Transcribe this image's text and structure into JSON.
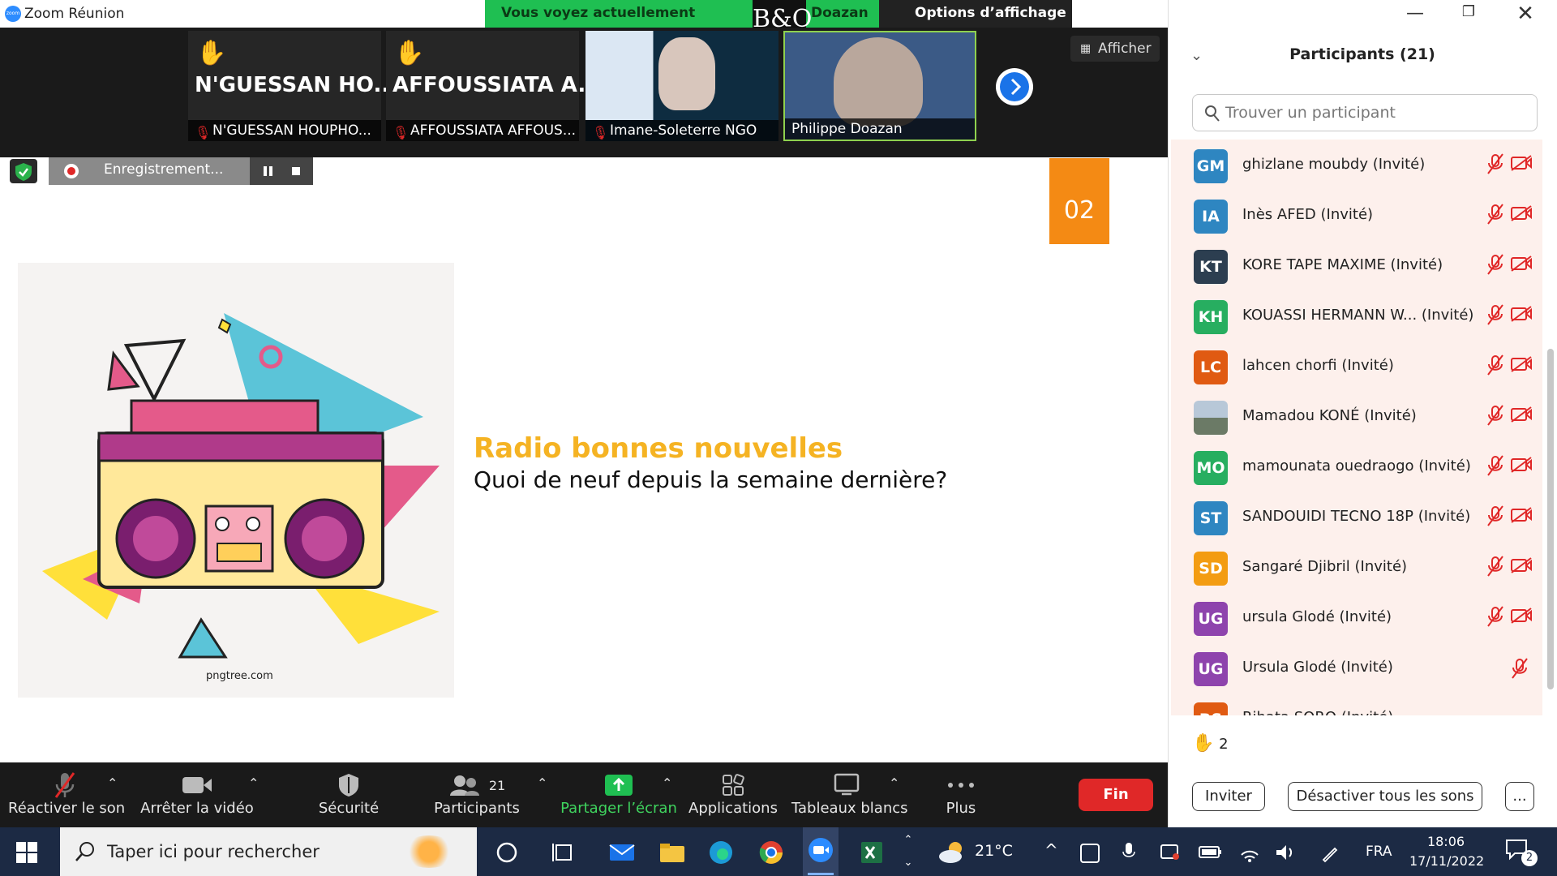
{
  "window": {
    "title": "Zoom Réunion",
    "share_banner_left": "Vous voyez actuellement l’écran de",
    "share_banner_right": "Doazan",
    "view_options": "Options d’affichage",
    "logo_text": "B&O"
  },
  "gallery": {
    "tiles": [
      {
        "big": "N'GUESSAN  HO...",
        "name": "N'GUESSAN HOUPHO...",
        "hand": true
      },
      {
        "big": "AFFOUSSIATA  A...",
        "name": "AFFOUSSIATA AFFOUS...",
        "hand": true
      },
      {
        "name": "Imane-Soleterre NGO"
      },
      {
        "name": "Philippe Doazan"
      }
    ],
    "afficher": "Afficher"
  },
  "recording": {
    "label": "Enregistrement..."
  },
  "slide": {
    "number": "02",
    "title": "Radio bonnes nouvelles",
    "subtitle": "Quoi de neuf depuis la semaine dernière?",
    "watermark": "pngtree.com"
  },
  "toolbar": {
    "unmute": "Réactiver le son",
    "stop_video": "Arrêter la vidéo",
    "security": "Sécurité",
    "participants": "Participants",
    "participants_count": "21",
    "share": "Partager l’écran",
    "apps": "Applications",
    "whiteboards": "Tableaux blancs",
    "more": "Plus",
    "end": "Fin"
  },
  "panel": {
    "title": "Participants (21)",
    "search_placeholder": "Trouver un participant",
    "participants": [
      {
        "initials": "GM",
        "name": "ghizlane moubdy (Invité)",
        "color": "#2e86c1",
        "video_off": true
      },
      {
        "initials": "IA",
        "name": "Inès AFED (Invité)",
        "color": "#2e86c1",
        "video_off": true
      },
      {
        "initials": "KT",
        "name": "KORE TAPE MAXIME (Invité)",
        "color": "#2c3e50",
        "video_off": true
      },
      {
        "initials": "KH",
        "name": "KOUASSI HERMANN W...  (Invité)",
        "color": "#27ae60",
        "video_off": true
      },
      {
        "initials": "LC",
        "name": "lahcen chorfi (Invité)",
        "color": "#e05a12",
        "video_off": true
      },
      {
        "initials": "",
        "name": "Mamadou KONÉ (Invité)",
        "color": "#7a8ea0",
        "video_off": true
      },
      {
        "initials": "MO",
        "name": "mamounata ouedraogo (Invité)",
        "color": "#27ae60",
        "video_off": true
      },
      {
        "initials": "ST",
        "name": "SANDOUIDI TECNO 18P (Invité)",
        "color": "#2e86c1",
        "video_off": true
      },
      {
        "initials": "SD",
        "name": "Sangaré Djibril (Invité)",
        "color": "#f39c12",
        "video_off": true
      },
      {
        "initials": "UG",
        "name": "ursula Glodé (Invité)",
        "color": "#8e44ad",
        "video_off": true
      },
      {
        "initials": "UG",
        "name": "Ursula Glodé (Invité)",
        "color": "#8e44ad",
        "video_off": false
      },
      {
        "initials": "RS",
        "name": "Rihata SORO (Invité)",
        "color": "#e05a12",
        "video_off": false
      }
    ],
    "raised_hands": "2",
    "invite": "Inviter",
    "mute_all": "Désactiver tous les sons",
    "more": "..."
  },
  "taskbar": {
    "search_placeholder": "Taper ici pour rechercher",
    "temperature": "21°C",
    "language": "FRA",
    "time": "18:06",
    "date": "17/11/2022",
    "notifications": "2"
  }
}
